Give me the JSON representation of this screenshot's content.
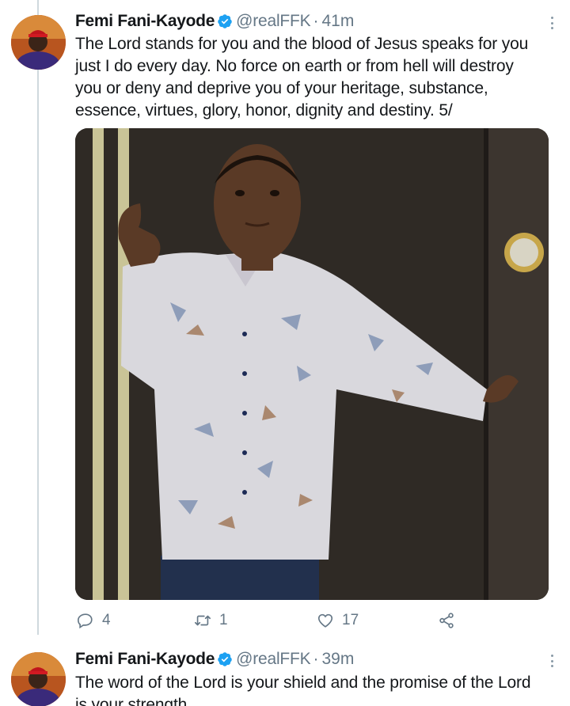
{
  "thread": {
    "tweets": [
      {
        "author_name": "Femi Fani-Kayode",
        "handle": "@realFFK",
        "separator": "·",
        "time": "41m",
        "text": "The Lord stands for you and the blood of Jesus speaks for you\njust I do every day. No force on earth or from hell will destroy\nyou or deny and deprive you of your heritage, substance,\nessence, virtues, glory, honor, dignity and destiny. 5/",
        "reply_count": "4",
        "retweet_count": "1",
        "like_count": "17"
      },
      {
        "author_name": "Femi Fani-Kayode",
        "handle": "@realFFK",
        "separator": "·",
        "time": "39m",
        "text": "The word of the Lord is your shield and the promise of the Lord\nis your strength"
      }
    ]
  },
  "icons": {
    "verified": "verified-badge-icon",
    "more": "more-vertical-icon",
    "reply": "reply-icon",
    "retweet": "retweet-icon",
    "like": "heart-icon",
    "share": "share-icon"
  },
  "colors": {
    "verified": "#1da1f2",
    "secondary_text": "#657786",
    "primary_text": "#14171a",
    "thread_line": "#cfd9de"
  }
}
